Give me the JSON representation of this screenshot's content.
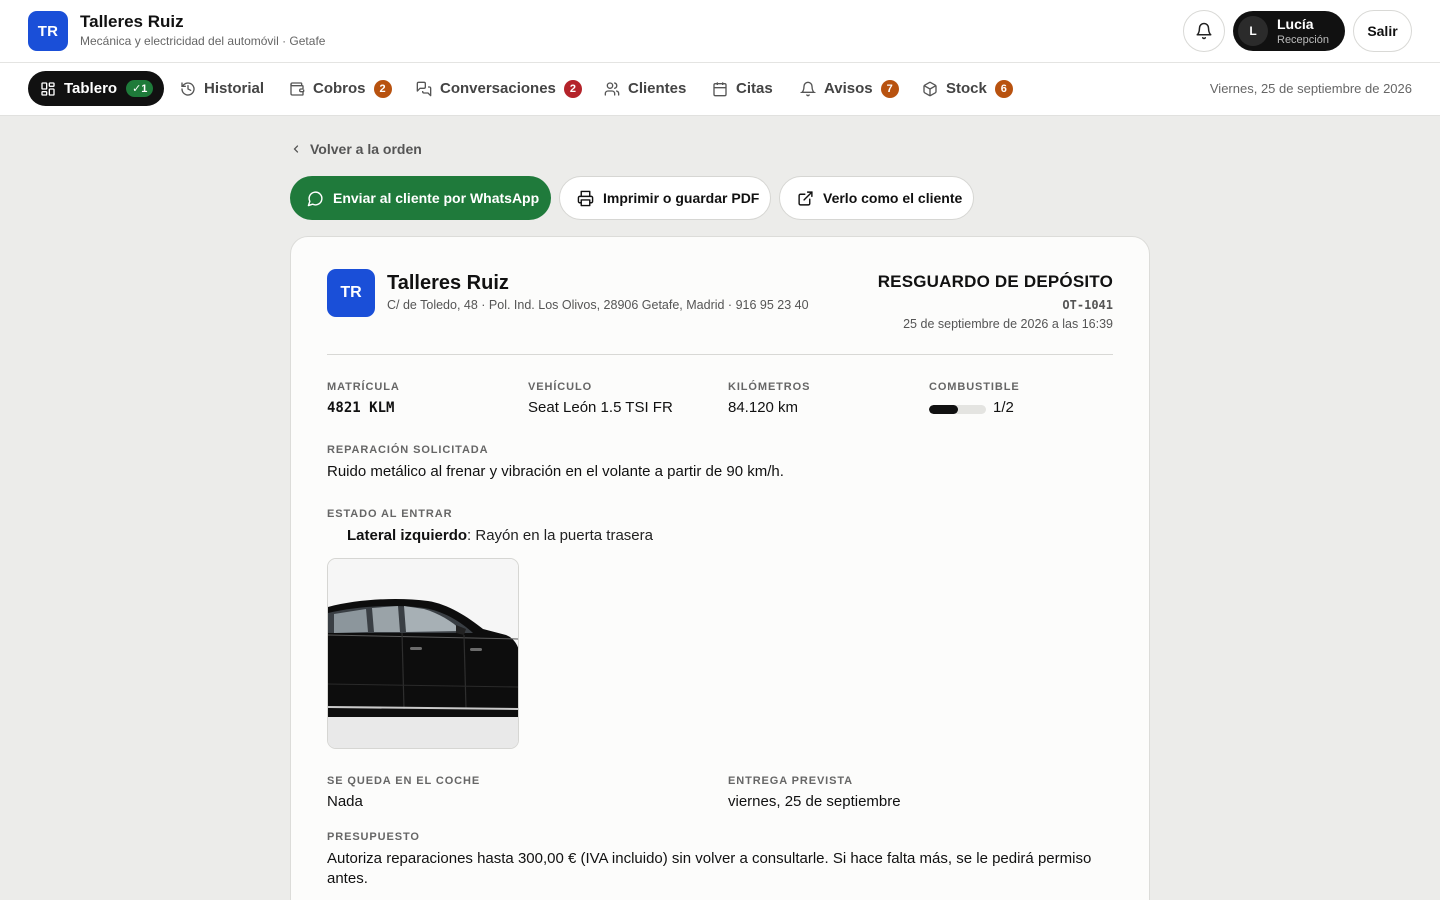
{
  "app": {
    "logo_initials": "TR",
    "name": "Talleres Ruiz",
    "subtitle": "Mecánica y electricidad del automóvil · Getafe"
  },
  "header": {
    "user_initial": "L",
    "user_name": "Lucía",
    "user_role": "Recepción",
    "logout_label": "Salir"
  },
  "nav": {
    "items": [
      {
        "label": "Tablero",
        "badge": "✓1",
        "icon": "dashboard-icon"
      },
      {
        "label": "Historial",
        "icon": "history-icon"
      },
      {
        "label": "Cobros",
        "badge": "2",
        "icon": "wallet-icon"
      },
      {
        "label": "Conversaciones",
        "badge": "2",
        "icon": "chat-icon"
      },
      {
        "label": "Clientes",
        "icon": "users-icon"
      },
      {
        "label": "Citas",
        "icon": "calendar-icon"
      },
      {
        "label": "Avisos",
        "badge": "7",
        "icon": "bell-icon"
      },
      {
        "label": "Stock",
        "badge": "6",
        "icon": "box-icon"
      }
    ],
    "date": "Viernes, 25 de septiembre de 2026"
  },
  "actions": {
    "back": "Volver a la orden",
    "whatsapp": "Enviar al cliente por WhatsApp",
    "pdf": "Imprimir o guardar PDF",
    "view": "Verlo como el cliente"
  },
  "document": {
    "logo_initials": "TR",
    "company": "Talleres Ruiz",
    "address": "C/ de Toledo, 48 · Pol. Ind. Los Olivos, 28906 Getafe, Madrid · 916 95 23 40",
    "title": "RESGUARDO DE DEPÓSITO",
    "code": "OT-1041",
    "datetime": "25 de septiembre de 2026 a las 16:39",
    "fields": {
      "plate_label": "MATRÍCULA",
      "plate": "4821 KLM",
      "vehicle_label": "VEHÍCULO",
      "vehicle": "Seat León 1.5 TSI FR",
      "km_label": "KILÓMETROS",
      "km": "84.120 km",
      "fuel_label": "COMBUSTIBLE",
      "fuel": "1/2",
      "fuel_level": 0.5
    },
    "repair_label": "REPARACIÓN SOLICITADA",
    "repair": "Ruido metálico al frenar y vibración en el volante a partir de 90 km/h.",
    "condition_label": "ESTADO AL ENTRAR",
    "condition_part": "Lateral izquierdo",
    "condition_desc": ": Rayón en la puerta trasera",
    "stays_label": "SE QUEDA EN EL COCHE",
    "stays": "Nada",
    "delivery_label": "ENTREGA PREVISTA",
    "delivery": "viernes, 25 de septiembre",
    "budget_label": "PRESUPUESTO",
    "budget": "Autoriza reparaciones hasta 300,00 € (IVA incluido) sin volver a consultarle. Si hace falta más, se le pedirá permiso antes."
  },
  "colors": {
    "brand": "#1a4fd8",
    "whatsapp": "#1f7a3b",
    "badge_ok": "#1e7b3a",
    "badge_red": "#b4232a",
    "badge_orange": "#b8520f"
  }
}
